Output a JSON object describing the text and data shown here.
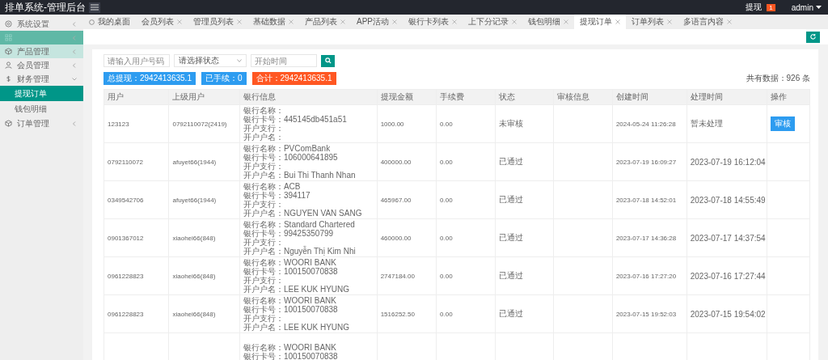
{
  "header": {
    "title": "排单系统-管理后台",
    "notice": {
      "label": "提现",
      "badge": "1"
    },
    "user": "admin"
  },
  "sidebar": {
    "items": [
      {
        "label": "系统设置",
        "selected": false,
        "hovered": false,
        "expanded": false
      },
      {
        "selected": true,
        "hovered": false,
        "expanded": false
      },
      {
        "label": "产品管理",
        "selected": false,
        "hovered": true,
        "expanded": false
      },
      {
        "label": "会员管理",
        "selected": false,
        "hovered": false,
        "expanded": false
      },
      {
        "label": "财务管理",
        "selected": false,
        "hovered": false,
        "expanded": true,
        "children": [
          {
            "label": "提现订单",
            "selected": true
          },
          {
            "label": "钱包明细",
            "selected": false
          }
        ]
      },
      {
        "label": "订单管理",
        "selected": false,
        "hovered": false,
        "expanded": false
      }
    ]
  },
  "tabs": [
    {
      "label": "我的桌面",
      "kind": "home",
      "selected": false
    },
    {
      "label": "会员列表",
      "kind": "page",
      "selected": false
    },
    {
      "label": "管理员列表",
      "kind": "page",
      "selected": false
    },
    {
      "label": "基础数据",
      "kind": "page",
      "selected": false
    },
    {
      "label": "产品列表",
      "kind": "page",
      "selected": false
    },
    {
      "label": "APP活动",
      "kind": "page",
      "selected": false
    },
    {
      "label": "银行卡列表",
      "kind": "page",
      "selected": false
    },
    {
      "label": "上下分记录",
      "kind": "page",
      "selected": false
    },
    {
      "label": "钱包明细",
      "kind": "page",
      "selected": false
    },
    {
      "label": "提现订单",
      "kind": "page",
      "selected": true
    },
    {
      "label": "订单列表",
      "kind": "page",
      "selected": false
    },
    {
      "label": "多语言内容",
      "kind": "page",
      "selected": false
    }
  ],
  "filters": {
    "user": {
      "placeholder": "请输入用户号码"
    },
    "status": {
      "placeholder": "请选择状态"
    },
    "start_time": {
      "placeholder": "开始时间"
    }
  },
  "stats": [
    {
      "label": "总提现：2942413635.1",
      "color": "#2d9cf0"
    },
    {
      "label": "已手续：0",
      "color": "#2d9cf0"
    },
    {
      "label": "合计：2942413635.1",
      "color": "#ff5722"
    }
  ],
  "count": "共有数据：926 条",
  "table": {
    "columns": [
      "用户",
      "上级用户",
      "银行信息",
      "提现金额",
      "手续费",
      "状态",
      "审核信息",
      "创建时间",
      "处理时间",
      "操作"
    ],
    "rows": [
      {
        "user": "123123",
        "parent": "0792110072(2419)",
        "bank": [
          "银行名称：",
          "银行卡号：445145db451a51",
          "开户支行：",
          "开户户名："
        ],
        "amount": "1000.00",
        "fee": "0.00",
        "status": "未审核",
        "created": "2024-05-24 11:26:28",
        "processed": "暂未处理",
        "action": "审核"
      },
      {
        "user": "0792110072",
        "parent": "afuyet66(1944)",
        "bank": [
          "银行名称：PVComBank",
          "银行卡号：106000641895",
          "开户支行：",
          "开户户名：Bui Thi Thanh Nhan"
        ],
        "amount": "400000.00",
        "fee": "0.00",
        "status": "已通过",
        "created": "2023-07-19 16:09:27",
        "processed": "2023-07-19 16:12:04"
      },
      {
        "user": "0349542706",
        "parent": "afuyet66(1944)",
        "bank": [
          "银行名称：ACB",
          "银行卡号：394117",
          "开户支行：",
          "开户户名：NGUYEN VAN SANG"
        ],
        "amount": "465967.00",
        "fee": "0.00",
        "status": "已通过",
        "created": "2023-07-18 14:52:01",
        "processed": "2023-07-18 14:55:49"
      },
      {
        "user": "0901367012",
        "parent": "xiaohei66(848)",
        "bank": [
          "银行名称：Standard Chartered",
          "银行卡号：99425350799",
          "开户支行：",
          "开户户名：Nguyễn Thị Kim Nhi"
        ],
        "amount": "460000.00",
        "fee": "0.00",
        "status": "已通过",
        "created": "2023-07-17 14:36:28",
        "processed": "2023-07-17 14:37:54"
      },
      {
        "user": "0961228823",
        "parent": "xiaohei66(848)",
        "bank": [
          "银行名称：WOORI BANK",
          "银行卡号：100150070838",
          "开户支行：",
          "开户户名：LEE KUK HYUNG"
        ],
        "amount": "2747184.00",
        "fee": "0.00",
        "status": "已通过",
        "created": "2023-07-16 17:27:20",
        "processed": "2023-07-16 17:27:44"
      },
      {
        "user": "0961228823",
        "parent": "xiaohei66(848)",
        "bank": [
          "银行名称：WOORI BANK",
          "银行卡号：100150070838",
          "开户支行：",
          "开户户名：LEE KUK HYUNG"
        ],
        "amount": "1516252.50",
        "fee": "0.00",
        "status": "已通过",
        "created": "2023-07-15 19:52:03",
        "processed": "2023-07-15 19:54:02"
      },
      {
        "bank": [
          "银行名称：WOORI BANK",
          "银行卡号：100150070838"
        ]
      }
    ]
  }
}
